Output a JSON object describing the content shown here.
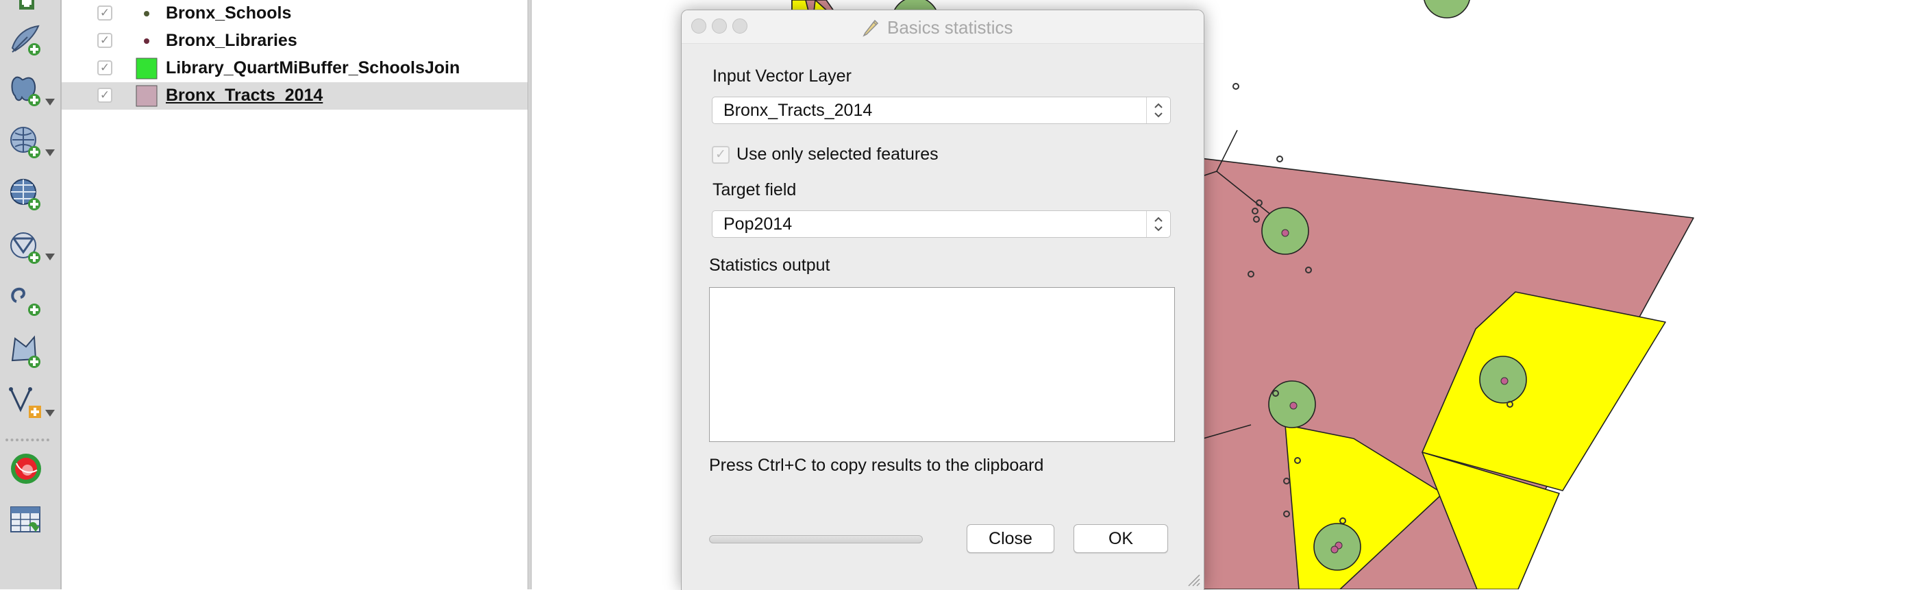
{
  "toolbar": {
    "tools": [
      {
        "icon": "add-layer-icon"
      },
      {
        "icon": "add-spatialite-layer-icon"
      },
      {
        "icon": "add-postgis-layer-icon"
      },
      {
        "icon": "add-wms-layer-icon"
      },
      {
        "icon": "add-wcs-layer-icon"
      },
      {
        "icon": "add-wfs-layer-icon"
      },
      {
        "icon": "add-delimited-text-layer-icon"
      },
      {
        "icon": "new-shapefile-layer-icon"
      },
      {
        "icon": "new-spatialite-layer-icon"
      },
      {
        "icon": "heatmap-plugin-icon"
      },
      {
        "icon": "table-manager-icon"
      }
    ]
  },
  "layers": [
    {
      "name": "Bronx_Schools",
      "checked": true,
      "symbol": "point",
      "color": "#4e5a34"
    },
    {
      "name": "Bronx_Libraries",
      "checked": true,
      "symbol": "point",
      "color": "#6b2a3c"
    },
    {
      "name": "Library_QuartMiBuffer_SchoolsJoin",
      "checked": true,
      "symbol": "fill",
      "color": "#33e233"
    },
    {
      "name": "Bronx_Tracts_2014",
      "checked": true,
      "symbol": "fill",
      "color": "#c8a6b4",
      "selected": true
    }
  ],
  "map": {
    "tract_fill": "#cd888d",
    "highlight_fill": "#ffff00",
    "buffer_fill": "#8fbf74",
    "library_point": "#c06090"
  },
  "dialog": {
    "title": "Basics statistics",
    "input_layer_label": "Input Vector Layer",
    "input_layer_value": "Bronx_Tracts_2014",
    "selected_only_label": "Use only selected features",
    "target_field_label": "Target field",
    "target_field_value": "Pop2014",
    "stats_output_label": "Statistics output",
    "stats_output_text": "",
    "hint": "Press Ctrl+C to copy results to the clipboard",
    "close_label": "Close",
    "ok_label": "OK"
  }
}
